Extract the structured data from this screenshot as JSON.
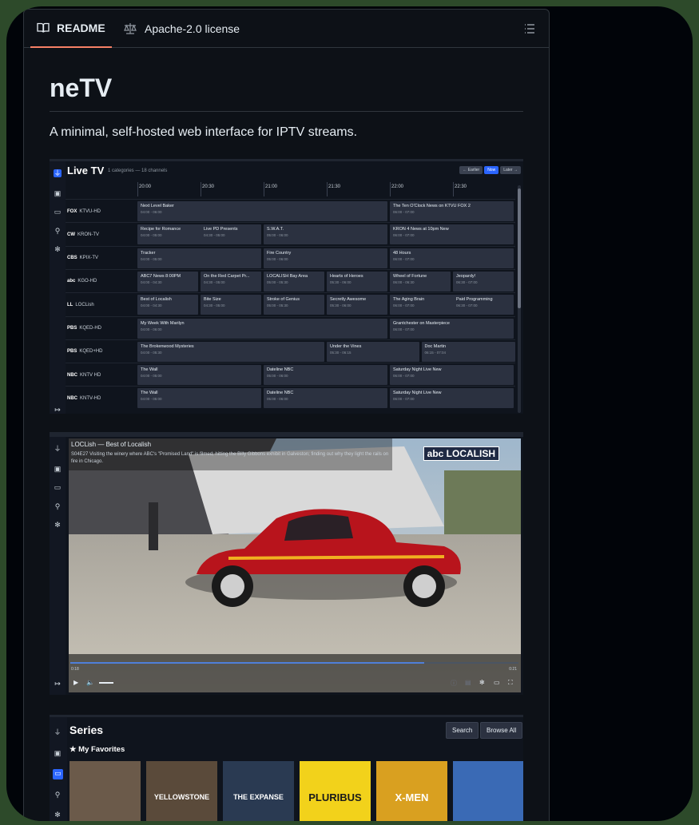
{
  "tabs": {
    "readme_label": "README",
    "license_label": "Apache-2.0 license"
  },
  "readme": {
    "title": "neTV",
    "tagline": "A minimal, self-hosted web interface for IPTV streams."
  },
  "livetv": {
    "title": "Live TV",
    "subtitle": "1 categories — 18 channels",
    "buttons": {
      "earlier": "← Earlier",
      "now": "Now",
      "later": "Later →"
    },
    "times": [
      "20:00",
      "20:30",
      "21:00",
      "21:30",
      "22:00",
      "22:30"
    ],
    "channels": [
      {
        "logo": "FOX",
        "name": "KTVU-HD",
        "programs": [
          {
            "title": "Next Level Baker",
            "time": "04:00 - 06:00"
          },
          {
            "title": "The Ten O'Clock News on KTVU FOX 2",
            "time": "06:00 - 07:00"
          }
        ]
      },
      {
        "logo": "CW",
        "name": "KRON-TV",
        "programs": [
          {
            "title": "Recipe for Romance",
            "time": "04:00 - 05:00"
          },
          {
            "title": "Live PD Presents",
            "time": "04:30 - 05:00"
          },
          {
            "title": "S.W.A.T.",
            "time": "05:00 - 06:00"
          },
          {
            "title": "KRON 4 News at 10pm New",
            "time": "06:00 - 07:00"
          }
        ]
      },
      {
        "logo": "CBS",
        "name": "KPIX-TV",
        "programs": [
          {
            "title": "Tracker",
            "time": "04:00 - 05:00"
          },
          {
            "title": "Fire Country",
            "time": "05:00 - 06:00"
          },
          {
            "title": "48 Hours",
            "time": "06:00 - 07:00"
          }
        ]
      },
      {
        "logo": "abc",
        "name": "KGO-HD",
        "programs": [
          {
            "title": "ABC7 News 8:00PM",
            "time": "04:00 - 04:30"
          },
          {
            "title": "On the Red Carpet Pr...",
            "time": "04:30 - 05:00"
          },
          {
            "title": "LOCALISH Bay Area",
            "time": "05:00 - 05:30"
          },
          {
            "title": "Hearts of Heroes",
            "time": "05:30 - 06:00"
          },
          {
            "title": "Wheel of Fortune",
            "time": "06:00 - 06:30"
          },
          {
            "title": "Jeopardy!",
            "time": "06:30 - 07:00"
          }
        ]
      },
      {
        "logo": "LL",
        "name": "LOCLish",
        "programs": [
          {
            "title": "Best of Localish",
            "time": "04:00 - 04:30"
          },
          {
            "title": "Bite Size",
            "time": "04:30 - 05:00"
          },
          {
            "title": "Stroke of Genius",
            "time": "05:00 - 05:30"
          },
          {
            "title": "Secretly Awesome",
            "time": "05:30 - 06:00"
          },
          {
            "title": "The Aging Brain",
            "time": "06:00 - 07:00"
          },
          {
            "title": "Paid Programming",
            "time": "06:30 - 07:00"
          }
        ]
      },
      {
        "logo": "PBS",
        "name": "KQED-HD",
        "programs": [
          {
            "title": "My Week With Marilyn",
            "time": "04:00 - 06:00"
          },
          {
            "title": "Grantchester on Masterpiece",
            "time": "06:00 - 07:00"
          }
        ]
      },
      {
        "logo": "PBS",
        "name": "KQED+HD",
        "programs": [
          {
            "title": "The Brokenwood Mysteries",
            "time": "04:00 - 05:30"
          },
          {
            "title": "Under the Vines",
            "time": "05:30 - 06:15"
          },
          {
            "title": "Doc Martin",
            "time": "06:15 - 07:04"
          }
        ]
      },
      {
        "logo": "NBC",
        "name": "KNTV HD",
        "programs": [
          {
            "title": "The Wall",
            "time": "04:00 - 05:00"
          },
          {
            "title": "Dateline NBC",
            "time": "05:00 - 06:00"
          },
          {
            "title": "Saturday Night Live New",
            "time": "06:00 - 07:00"
          }
        ]
      },
      {
        "logo": "NBC",
        "name": "KNTV-HD",
        "programs": [
          {
            "title": "The Wall",
            "time": "04:00 - 05:00"
          },
          {
            "title": "Dateline NBC",
            "time": "05:00 - 06:00"
          },
          {
            "title": "Saturday Night Live New",
            "time": "06:00 - 07:00"
          }
        ]
      }
    ]
  },
  "player": {
    "title": "LOCLish — Best of Localish",
    "description": "S04E27 Visiting the winery where ABC's \"Promised Land\" is filmed; hitting the Billy Gibbons exhibit in Galveston; finding out why they light the rails on fire in Chicago.",
    "logo_text": "abc LOCALISH",
    "time_current": "0:18",
    "time_total": "0:21",
    "progress": 0.79
  },
  "series": {
    "title": "Series",
    "search_label": "Search",
    "browse_label": "Browse All",
    "favorites_label": "★ My Favorites",
    "posters": [
      {
        "label": "",
        "bg": "#6b5a4a"
      },
      {
        "label": "YELLOWSTONE",
        "bg": "#5a4a3a"
      },
      {
        "label": "THE EXPANSE",
        "bg": "#2a3a52"
      },
      {
        "label": "PLURIBUS",
        "bg": "#f2d21b"
      },
      {
        "label": "X-MEN",
        "bg": "#d9a020"
      },
      {
        "label": "",
        "bg": "#3a6ab5"
      }
    ]
  }
}
